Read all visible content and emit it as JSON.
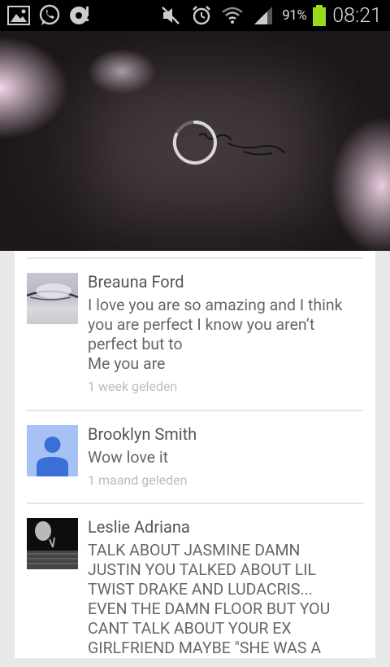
{
  "status_bar": {
    "battery_pct": "91%",
    "time": "08:21",
    "left_icons": [
      "gallery-icon",
      "whatsapp-icon",
      "sync-icon"
    ],
    "right_icons": [
      "mute-icon",
      "alarm-icon",
      "wifi-icon",
      "signal-icon",
      "battery-icon"
    ]
  },
  "video": {
    "state": "loading"
  },
  "comments": [
    {
      "author": "Breauna Ford",
      "text": "I love you are so amazing and I think\nyou are perfect I know you aren’t\nperfect but to\nMe you are",
      "time": "1 week geleden"
    },
    {
      "author": "Brooklyn Smith",
      "text": "Wow love it",
      "time": "1 maand geleden"
    },
    {
      "author": "Leslie Adriana",
      "text": "TALK ABOUT JASMINE DAMN\nJUSTIN YOU TALKED ABOUT LIL\nTWIST DRAKE AND LUDACRIS...\nEVEN THE DAMN FLOOR BUT YOU\nCANT TALK ABOUT YOUR EX\nGIRLFRIEND MAYBE \"SHE WAS A",
      "time": ""
    }
  ],
  "colors": {
    "default_avatar_bg": "#a6c2f4",
    "default_avatar_fg": "#3a6fd8"
  }
}
